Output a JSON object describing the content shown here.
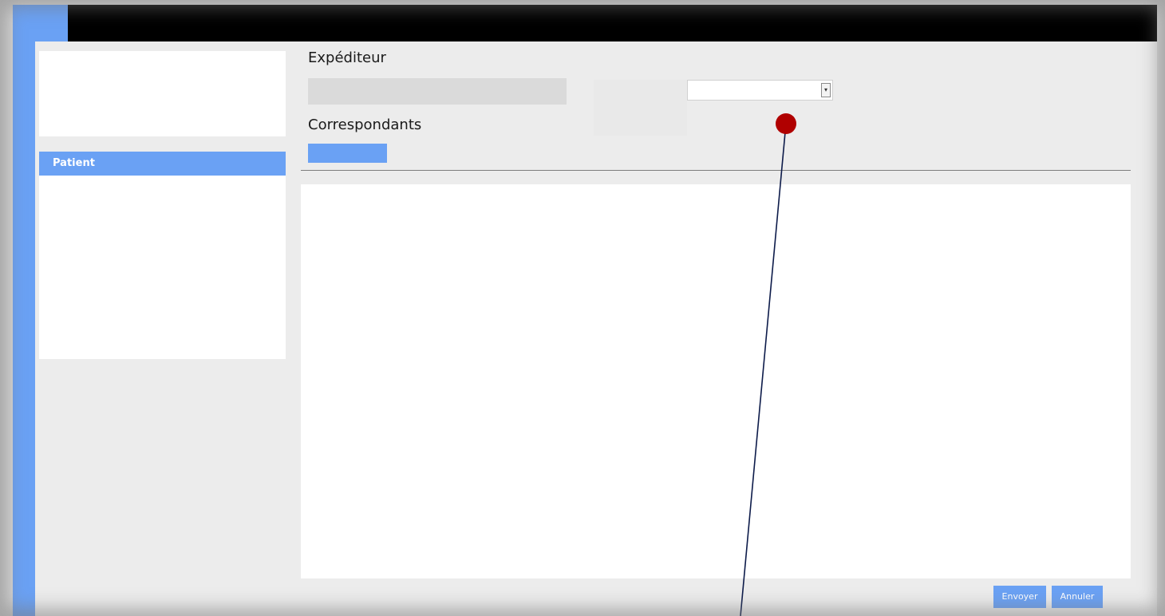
{
  "sidebar": {
    "header_label": "Patient"
  },
  "form": {
    "sender_title": "Expéditeur",
    "recipients_title": "Correspondants",
    "select_arrow_glyph": "▾"
  },
  "footer": {
    "send_label": "Envoyer",
    "cancel_label": "Annuler"
  },
  "colors": {
    "accent": "#6aa1f4",
    "top_bar": "#000000",
    "annotation_dot": "#b00000",
    "annotation_line": "#0d1b4a"
  }
}
